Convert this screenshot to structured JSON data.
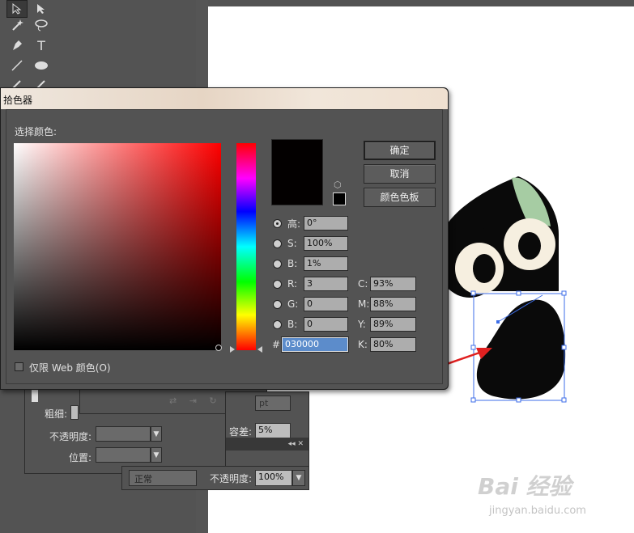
{
  "dialog": {
    "title": "拾色器",
    "select_color_label": "选择颜色:",
    "ok_button": "确定",
    "cancel_button": "取消",
    "swatches_button": "颜色色板",
    "web_only_label": "仅限 Web 颜色(O)",
    "current_color": "#030000",
    "hue_label": "高:",
    "hue_value": "0°",
    "s_label": "S:",
    "s_value": "100%",
    "b_label": "B:",
    "b_value": "1%",
    "r_label": "R:",
    "r_value": "3",
    "g_label": "G:",
    "g_value": "0",
    "blue_label": "B:",
    "blue_value": "0",
    "hex_label": "#",
    "hex_value": "030000",
    "c_label": "C:",
    "c_value": "93%",
    "m_label": "M:",
    "m_value": "88%",
    "y_label": "Y:",
    "y_value": "89%",
    "k_label": "K:",
    "k_value": "80%"
  },
  "bg_panels": {
    "stroke_label": "粗细:",
    "opacity_label": "不透明度:",
    "position_label": "位置:",
    "pt_suffix": "pt",
    "tolerance_label": "容差:",
    "tolerance_value": "5%",
    "blend_mode": "正常",
    "layer_opacity_label": "不透明度:",
    "layer_opacity_value": "100%"
  },
  "watermark": {
    "brand": "Bai 经验",
    "url": "jingyan.baidu.com"
  },
  "colors": {
    "accent_arrow": "#e02020",
    "selection": "#3d6ee8",
    "cat_ear": "#a6cca3",
    "cat_eye": "#f6efe0"
  }
}
